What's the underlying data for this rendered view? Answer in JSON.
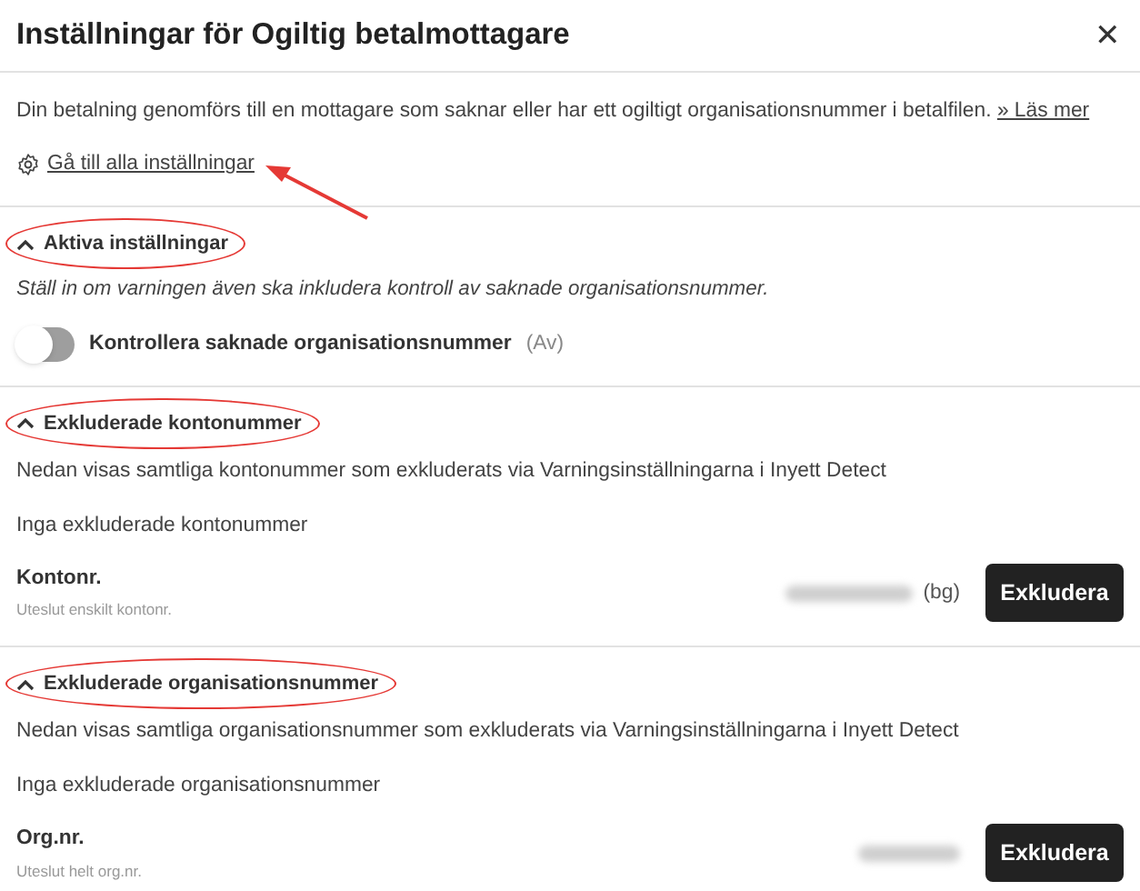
{
  "window": {
    "title": "Inställningar för Ogiltig betalmottagare",
    "close": "✕"
  },
  "intro": {
    "text": "Din betalning genomförs till en mottagare som saknar eller har ett ogiltigt organisationsnummer i betalfilen.",
    "link": "» Läs mer"
  },
  "settings_link": {
    "label": "Gå till alla inställningar",
    "annotated": true
  },
  "sections": [
    {
      "kind": "toggle",
      "title": "Aktiva inställningar",
      "expanded": true,
      "annotated": true,
      "hint": "Ställ in om varningen även ska inkludera kontroll av saknade organisationsnummer.",
      "toggle": {
        "label": "Kontrollera saknade organisationsnummer",
        "state_text": "(Av)",
        "on": false
      }
    },
    {
      "kind": "exclude",
      "title": "Exkluderade kontonummer",
      "expanded": true,
      "annotated": true,
      "description": "Nedan visas samtliga kontonummer som exkluderats via Varningsinställningarna i Inyett Detect",
      "empty_text": "Inga exkluderade kontonummer",
      "field_label": "Kontonr.",
      "field_hint": "Uteslut enskilt kontonr.",
      "suffix": "(bg)",
      "button": "Exkludera"
    },
    {
      "kind": "exclude",
      "title": "Exkluderade organisationsnummer",
      "expanded": true,
      "annotated": true,
      "description": "Nedan visas samtliga organisationsnummer som exkluderats via Varningsinställningarna i Inyett Detect",
      "empty_text": "Inga exkluderade organisationsnummer",
      "field_label": "Org.nr.",
      "field_hint": "Uteslut helt org.nr.",
      "button": "Exkludera"
    }
  ]
}
